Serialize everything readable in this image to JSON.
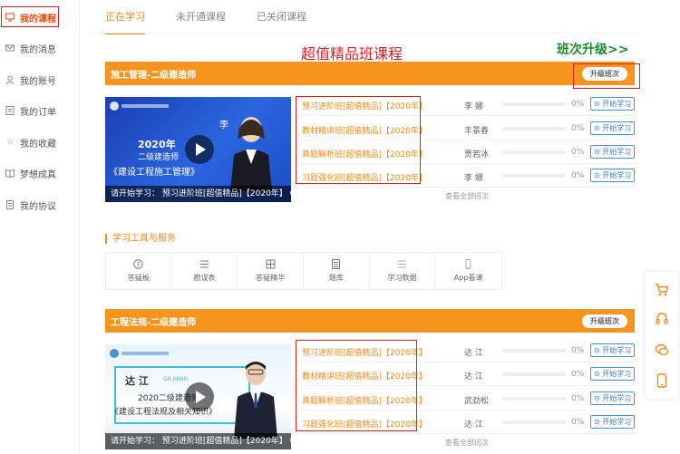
{
  "sidebar": {
    "items": [
      {
        "label": "我的课程",
        "icon": "course-icon",
        "active": true
      },
      {
        "label": "我的消息",
        "icon": "mail-icon",
        "active": false
      },
      {
        "label": "我的账号",
        "icon": "user-icon",
        "active": false
      },
      {
        "label": "我的订单",
        "icon": "order-icon",
        "active": false
      },
      {
        "label": "我的收藏",
        "icon": "star-icon",
        "active": false
      },
      {
        "label": "梦想成真",
        "icon": "book-icon",
        "active": false
      },
      {
        "label": "我的协议",
        "icon": "doc-icon",
        "active": false
      }
    ]
  },
  "tabs": [
    {
      "label": "正在学习",
      "active": true
    },
    {
      "label": "未开通课程",
      "active": false
    },
    {
      "label": "已关闭课程",
      "active": false
    }
  ],
  "promo": {
    "title": "超值精品班课程",
    "link": "班次升级>>"
  },
  "courses": [
    {
      "title": "施工管理-二级建造师",
      "upgrade_label": "升级班次",
      "thumb": {
        "year": "2020年",
        "cert": "二级建造师",
        "subject": "《建设工程施工管理》",
        "teacher_tag": "李",
        "caption": "请开始学习：  预习进阶班[超值精品]【2020年】 0%"
      },
      "classes": [
        {
          "name": "预习进阶班[超值精品]【2020年】",
          "teacher": "李    娜",
          "progress": "0%",
          "progress_value": 0,
          "action": "开始学习"
        },
        {
          "name": "教材精讲班[超值精品]【2020年】",
          "teacher": "丰景春",
          "progress": "0%",
          "progress_value": 0,
          "action": "开始学习"
        },
        {
          "name": "真题解析班[超值精品]【2020年】",
          "teacher": "贾若冰",
          "progress": "0%",
          "progress_value": 0,
          "action": "开始学习"
        },
        {
          "name": "习题强化班[超值精品]【2020年】",
          "teacher": "李    娜",
          "progress": "0%",
          "progress_value": 0,
          "action": "开始学习"
        }
      ],
      "view_all": "查看全部班次"
    },
    {
      "title": "工程法规-二级建造师",
      "upgrade_label": "升级班次",
      "thumb": {
        "teacher_name": "达  江",
        "teacher_pinyin": "DA JIANG",
        "cert": "2020二级建造师",
        "subject": "《建设工程法规及相关知识》",
        "caption": "请开始学习：  预习进阶班[超值精品]【2020年】 0%"
      },
      "classes": [
        {
          "name": "预习进阶班[超值精品]【2020年】",
          "teacher": "达    江",
          "progress": "0%",
          "progress_value": 0,
          "action": "开始学习"
        },
        {
          "name": "教材精讲班[超值精品]【2020年】",
          "teacher": "达    江",
          "progress": "0%",
          "progress_value": 0,
          "action": "开始学习"
        },
        {
          "name": "真题解析班[超值精品]【2020年】",
          "teacher": "武劲松",
          "progress": "0%",
          "progress_value": 0,
          "action": "开始学习"
        },
        {
          "name": "习题强化班[超值精品]【2020年】",
          "teacher": "达    江",
          "progress": "0%",
          "progress_value": 0,
          "action": "开始学习"
        }
      ],
      "view_all": "查看全部班次"
    }
  ],
  "tools": {
    "title": "学习工具与服务",
    "items": [
      {
        "label": "答疑板",
        "icon": "question-icon"
      },
      {
        "label": "勘误表",
        "icon": "list-icon"
      },
      {
        "label": "答疑精华",
        "icon": "grid-icon"
      },
      {
        "label": "题库",
        "icon": "doc-icon"
      },
      {
        "label": "学习数据",
        "icon": "data-icon"
      },
      {
        "label": "App看课",
        "icon": "phone-icon"
      }
    ]
  },
  "float_icons": [
    "cart-icon",
    "headset-icon",
    "chat-icon",
    "tablet-icon"
  ],
  "colors": {
    "accent": "#f7941d",
    "highlight": "#e02020",
    "promo_link": "#1a8a2a",
    "button_blue": "#3a7cc8"
  }
}
